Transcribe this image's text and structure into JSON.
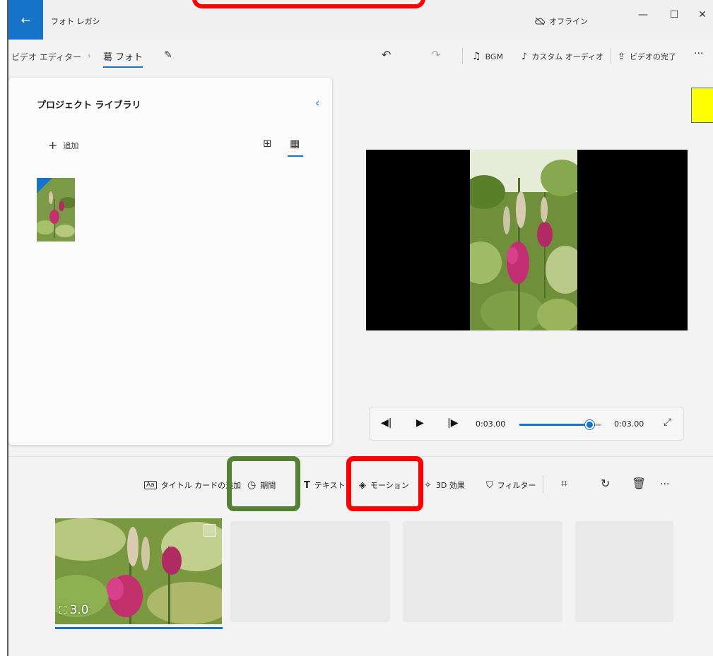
{
  "titlebar": {
    "back_icon": "←",
    "app_title": "フォト レガシ",
    "offline_label": "オフライン",
    "minimize": "—",
    "maximize": "☐",
    "close": "✕"
  },
  "toolbar": {
    "breadcrumb_root": "ビデオ エディター",
    "breadcrumb_sep": "›",
    "project_name": "葛 フォト",
    "undo_icon": "↶",
    "redo_icon": "↷",
    "bgm_label": "BGM",
    "custom_audio_label": "カスタム オーディオ",
    "finish_video_label": "ビデオの完了",
    "more": "···"
  },
  "library": {
    "title": "プロジェクト ライブラリ",
    "collapse_icon": "‹",
    "add_label": "追加",
    "add_icon": "+"
  },
  "playback": {
    "prev_icon": "◀|",
    "play_icon": "▶",
    "next_icon": "|▶",
    "current_time": "0:03.00",
    "total_time": "0:03.00",
    "progress": 0.85,
    "expand_icon": "⤢"
  },
  "storyboard": {
    "title_card_label": "タイトル カードの追加",
    "duration_label": "期間",
    "text_label": "テキスト",
    "motion_label": "モーション",
    "effects_3d_label": "3D 効果",
    "filter_label": "フィルター",
    "more": "···",
    "clip_duration": "3.0"
  },
  "colors": {
    "accent": "#1674c8",
    "annotation_red": "#ff0000",
    "annotation_green": "#548235",
    "annotation_yellow": "#ffff00"
  }
}
